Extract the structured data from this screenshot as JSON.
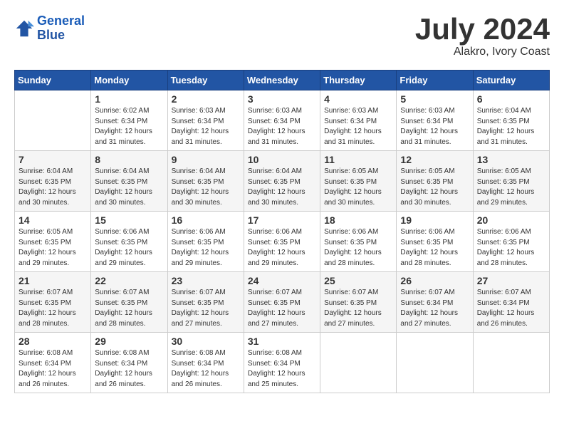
{
  "header": {
    "logo_line1": "General",
    "logo_line2": "Blue",
    "month": "July 2024",
    "location": "Alakro, Ivory Coast"
  },
  "weekdays": [
    "Sunday",
    "Monday",
    "Tuesday",
    "Wednesday",
    "Thursday",
    "Friday",
    "Saturday"
  ],
  "weeks": [
    [
      {
        "day": "",
        "sunrise": "",
        "sunset": "",
        "daylight": ""
      },
      {
        "day": "1",
        "sunrise": "Sunrise: 6:02 AM",
        "sunset": "Sunset: 6:34 PM",
        "daylight": "Daylight: 12 hours and 31 minutes."
      },
      {
        "day": "2",
        "sunrise": "Sunrise: 6:03 AM",
        "sunset": "Sunset: 6:34 PM",
        "daylight": "Daylight: 12 hours and 31 minutes."
      },
      {
        "day": "3",
        "sunrise": "Sunrise: 6:03 AM",
        "sunset": "Sunset: 6:34 PM",
        "daylight": "Daylight: 12 hours and 31 minutes."
      },
      {
        "day": "4",
        "sunrise": "Sunrise: 6:03 AM",
        "sunset": "Sunset: 6:34 PM",
        "daylight": "Daylight: 12 hours and 31 minutes."
      },
      {
        "day": "5",
        "sunrise": "Sunrise: 6:03 AM",
        "sunset": "Sunset: 6:34 PM",
        "daylight": "Daylight: 12 hours and 31 minutes."
      },
      {
        "day": "6",
        "sunrise": "Sunrise: 6:04 AM",
        "sunset": "Sunset: 6:35 PM",
        "daylight": "Daylight: 12 hours and 31 minutes."
      }
    ],
    [
      {
        "day": "7",
        "sunrise": "Sunrise: 6:04 AM",
        "sunset": "Sunset: 6:35 PM",
        "daylight": "Daylight: 12 hours and 30 minutes."
      },
      {
        "day": "8",
        "sunrise": "Sunrise: 6:04 AM",
        "sunset": "Sunset: 6:35 PM",
        "daylight": "Daylight: 12 hours and 30 minutes."
      },
      {
        "day": "9",
        "sunrise": "Sunrise: 6:04 AM",
        "sunset": "Sunset: 6:35 PM",
        "daylight": "Daylight: 12 hours and 30 minutes."
      },
      {
        "day": "10",
        "sunrise": "Sunrise: 6:04 AM",
        "sunset": "Sunset: 6:35 PM",
        "daylight": "Daylight: 12 hours and 30 minutes."
      },
      {
        "day": "11",
        "sunrise": "Sunrise: 6:05 AM",
        "sunset": "Sunset: 6:35 PM",
        "daylight": "Daylight: 12 hours and 30 minutes."
      },
      {
        "day": "12",
        "sunrise": "Sunrise: 6:05 AM",
        "sunset": "Sunset: 6:35 PM",
        "daylight": "Daylight: 12 hours and 30 minutes."
      },
      {
        "day": "13",
        "sunrise": "Sunrise: 6:05 AM",
        "sunset": "Sunset: 6:35 PM",
        "daylight": "Daylight: 12 hours and 29 minutes."
      }
    ],
    [
      {
        "day": "14",
        "sunrise": "Sunrise: 6:05 AM",
        "sunset": "Sunset: 6:35 PM",
        "daylight": "Daylight: 12 hours and 29 minutes."
      },
      {
        "day": "15",
        "sunrise": "Sunrise: 6:06 AM",
        "sunset": "Sunset: 6:35 PM",
        "daylight": "Daylight: 12 hours and 29 minutes."
      },
      {
        "day": "16",
        "sunrise": "Sunrise: 6:06 AM",
        "sunset": "Sunset: 6:35 PM",
        "daylight": "Daylight: 12 hours and 29 minutes."
      },
      {
        "day": "17",
        "sunrise": "Sunrise: 6:06 AM",
        "sunset": "Sunset: 6:35 PM",
        "daylight": "Daylight: 12 hours and 29 minutes."
      },
      {
        "day": "18",
        "sunrise": "Sunrise: 6:06 AM",
        "sunset": "Sunset: 6:35 PM",
        "daylight": "Daylight: 12 hours and 28 minutes."
      },
      {
        "day": "19",
        "sunrise": "Sunrise: 6:06 AM",
        "sunset": "Sunset: 6:35 PM",
        "daylight": "Daylight: 12 hours and 28 minutes."
      },
      {
        "day": "20",
        "sunrise": "Sunrise: 6:06 AM",
        "sunset": "Sunset: 6:35 PM",
        "daylight": "Daylight: 12 hours and 28 minutes."
      }
    ],
    [
      {
        "day": "21",
        "sunrise": "Sunrise: 6:07 AM",
        "sunset": "Sunset: 6:35 PM",
        "daylight": "Daylight: 12 hours and 28 minutes."
      },
      {
        "day": "22",
        "sunrise": "Sunrise: 6:07 AM",
        "sunset": "Sunset: 6:35 PM",
        "daylight": "Daylight: 12 hours and 28 minutes."
      },
      {
        "day": "23",
        "sunrise": "Sunrise: 6:07 AM",
        "sunset": "Sunset: 6:35 PM",
        "daylight": "Daylight: 12 hours and 27 minutes."
      },
      {
        "day": "24",
        "sunrise": "Sunrise: 6:07 AM",
        "sunset": "Sunset: 6:35 PM",
        "daylight": "Daylight: 12 hours and 27 minutes."
      },
      {
        "day": "25",
        "sunrise": "Sunrise: 6:07 AM",
        "sunset": "Sunset: 6:35 PM",
        "daylight": "Daylight: 12 hours and 27 minutes."
      },
      {
        "day": "26",
        "sunrise": "Sunrise: 6:07 AM",
        "sunset": "Sunset: 6:34 PM",
        "daylight": "Daylight: 12 hours and 27 minutes."
      },
      {
        "day": "27",
        "sunrise": "Sunrise: 6:07 AM",
        "sunset": "Sunset: 6:34 PM",
        "daylight": "Daylight: 12 hours and 26 minutes."
      }
    ],
    [
      {
        "day": "28",
        "sunrise": "Sunrise: 6:08 AM",
        "sunset": "Sunset: 6:34 PM",
        "daylight": "Daylight: 12 hours and 26 minutes."
      },
      {
        "day": "29",
        "sunrise": "Sunrise: 6:08 AM",
        "sunset": "Sunset: 6:34 PM",
        "daylight": "Daylight: 12 hours and 26 minutes."
      },
      {
        "day": "30",
        "sunrise": "Sunrise: 6:08 AM",
        "sunset": "Sunset: 6:34 PM",
        "daylight": "Daylight: 12 hours and 26 minutes."
      },
      {
        "day": "31",
        "sunrise": "Sunrise: 6:08 AM",
        "sunset": "Sunset: 6:34 PM",
        "daylight": "Daylight: 12 hours and 25 minutes."
      },
      {
        "day": "",
        "sunrise": "",
        "sunset": "",
        "daylight": ""
      },
      {
        "day": "",
        "sunrise": "",
        "sunset": "",
        "daylight": ""
      },
      {
        "day": "",
        "sunrise": "",
        "sunset": "",
        "daylight": ""
      }
    ]
  ]
}
